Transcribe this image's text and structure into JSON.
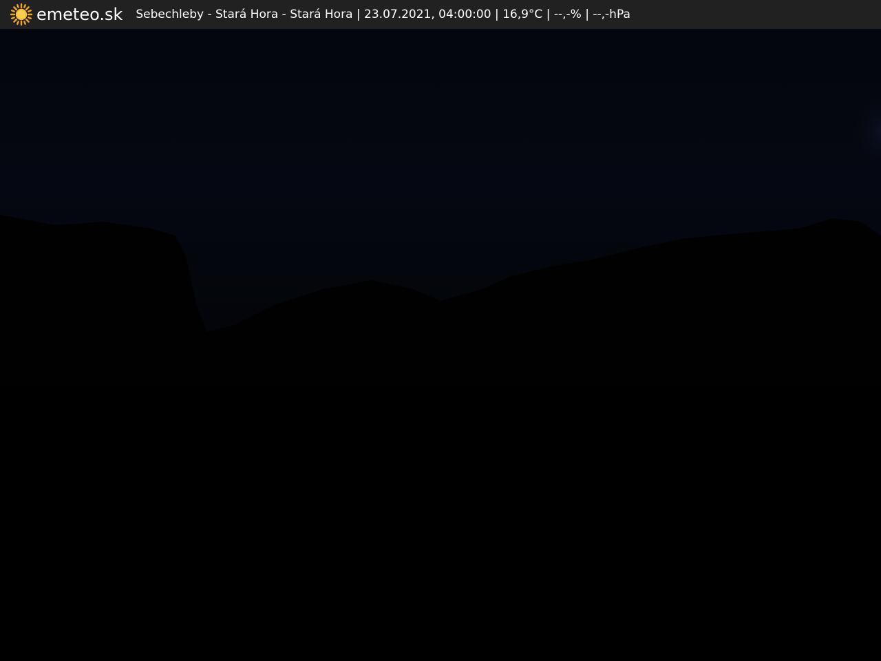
{
  "header": {
    "logo_icon": "sun-icon",
    "brand": "emeteo.sk",
    "station": "Sebechleby - Stará Hora - Stará Hora",
    "separator": "|",
    "datetime": "23.07.2021, 04:00:00",
    "temperature": "16,9°C",
    "humidity": "--,-%",
    "pressure": "--,-hPa"
  },
  "colors": {
    "bar_background": "#212121",
    "sun_accent": "#f5a623",
    "sky_top": "#05070f",
    "ground": "#000000"
  }
}
